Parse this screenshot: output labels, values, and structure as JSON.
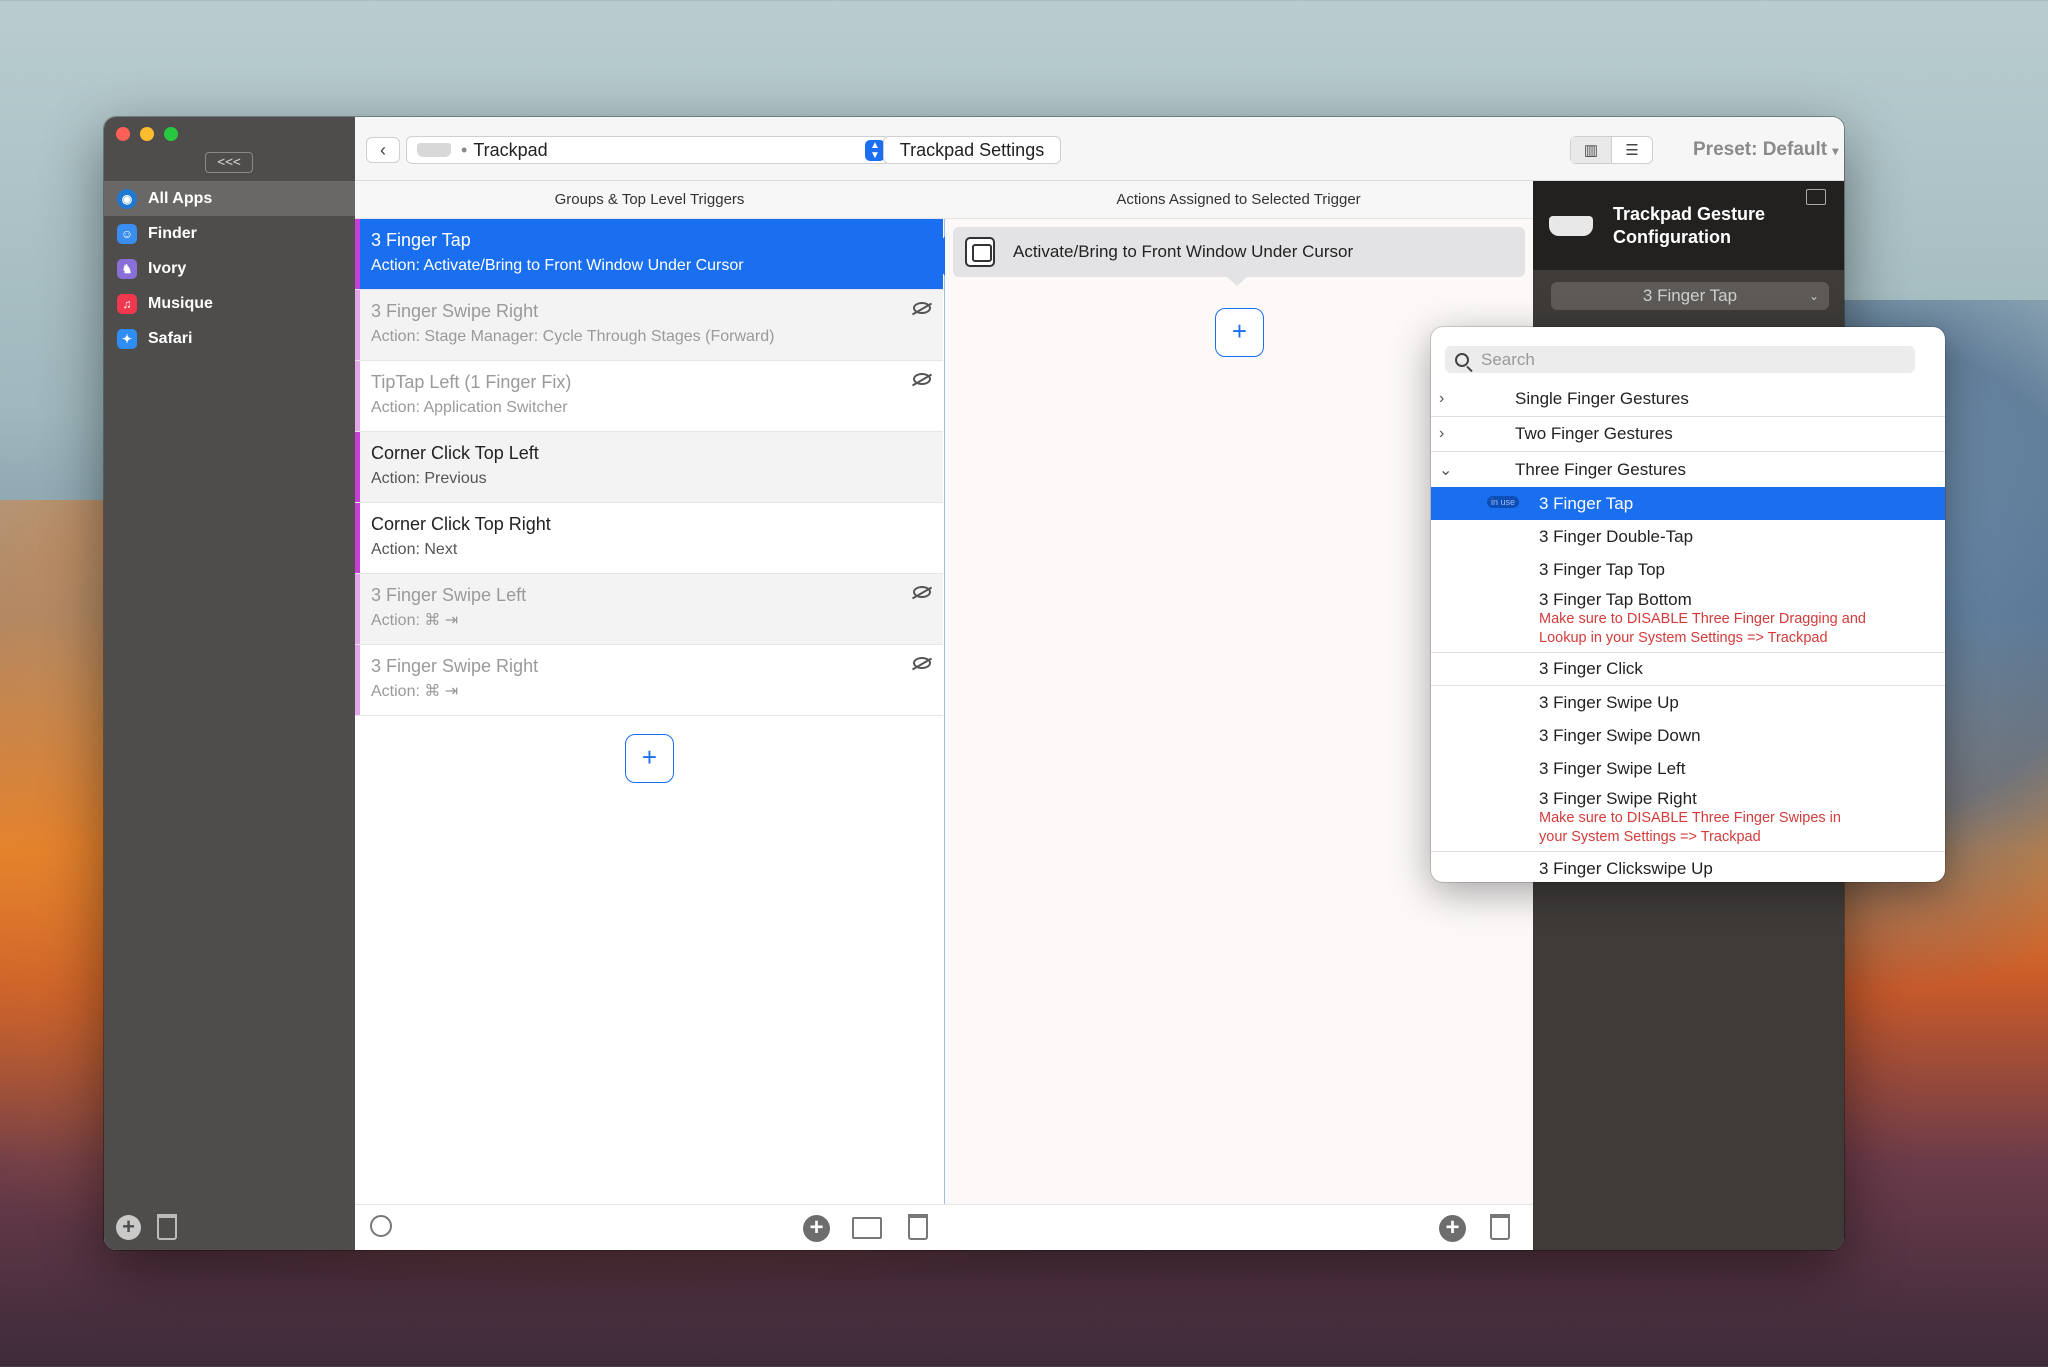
{
  "sidebar": {
    "collapse_label": "<<<",
    "apps": [
      {
        "label": "All Apps",
        "icon": "globe-icon",
        "color": "#1f78d1"
      },
      {
        "label": "Finder",
        "icon": "finder-icon",
        "color": "#3a8ef0"
      },
      {
        "label": "Ivory",
        "icon": "ivory-icon",
        "color": "#8b6fd8"
      },
      {
        "label": "Musique",
        "icon": "music-icon",
        "color": "#f0384e"
      },
      {
        "label": "Safari",
        "icon": "safari-icon",
        "color": "#2f8ef5"
      }
    ]
  },
  "toolbar": {
    "device": "Trackpad",
    "settings_button": "Trackpad Settings",
    "preset": "Preset: Default"
  },
  "columns": {
    "triggers_header": "Groups & Top Level Triggers",
    "actions_header": "Actions Assigned to Selected Trigger"
  },
  "triggers": [
    {
      "name": "3 Finger Tap",
      "action": "Action: Activate/Bring to Front Window Under Cursor"
    },
    {
      "name": "3 Finger Swipe Right",
      "action": "Action: Stage Manager: Cycle Through Stages (Forward)"
    },
    {
      "name": "TipTap Left (1 Finger Fix)",
      "action": "Action: Application Switcher"
    },
    {
      "name": "Corner Click Top Left",
      "action": "Action: Previous"
    },
    {
      "name": "Corner Click Top Right",
      "action": "Action: Next"
    },
    {
      "name": "3 Finger Swipe Left",
      "action": "Action: ⌘ ⇥"
    },
    {
      "name": "3 Finger Swipe Right",
      "action": "Action: ⌘ ⇥"
    }
  ],
  "action_item": "Activate/Bring to Front Window Under Cursor",
  "config": {
    "title_line1": "Trackpad Gesture",
    "title_line2": "Configuration",
    "selected_gesture": "3 Finger Tap"
  },
  "popup": {
    "search_placeholder": "Search",
    "categories": [
      "Single Finger Gestures",
      "Two Finger Gestures",
      "Three Finger Gestures"
    ],
    "in_use_badge": "in use",
    "options": [
      {
        "label": "3 Finger Tap"
      },
      {
        "label": "3 Finger Double-Tap"
      },
      {
        "label": "3 Finger Tap Top"
      },
      {
        "label": "3 Finger Tap Bottom",
        "warning1": "Make sure to DISABLE Three Finger Dragging and",
        "warning2": "Lookup in your System Settings => Trackpad"
      },
      {
        "label": "3 Finger Click"
      },
      {
        "label": "3 Finger Swipe Up"
      },
      {
        "label": "3 Finger Swipe Down"
      },
      {
        "label": "3 Finger Swipe Left"
      },
      {
        "label": "3 Finger Swipe Right",
        "warning1": "Make sure to DISABLE Three Finger Swipes in",
        "warning2": "your System Settings => Trackpad"
      },
      {
        "label": "3 Finger Clickswipe Up"
      }
    ]
  },
  "colors": {
    "accent": "#1a6ff0",
    "trigger_bar": "#c53fd6",
    "warning": "#d43b3b"
  }
}
